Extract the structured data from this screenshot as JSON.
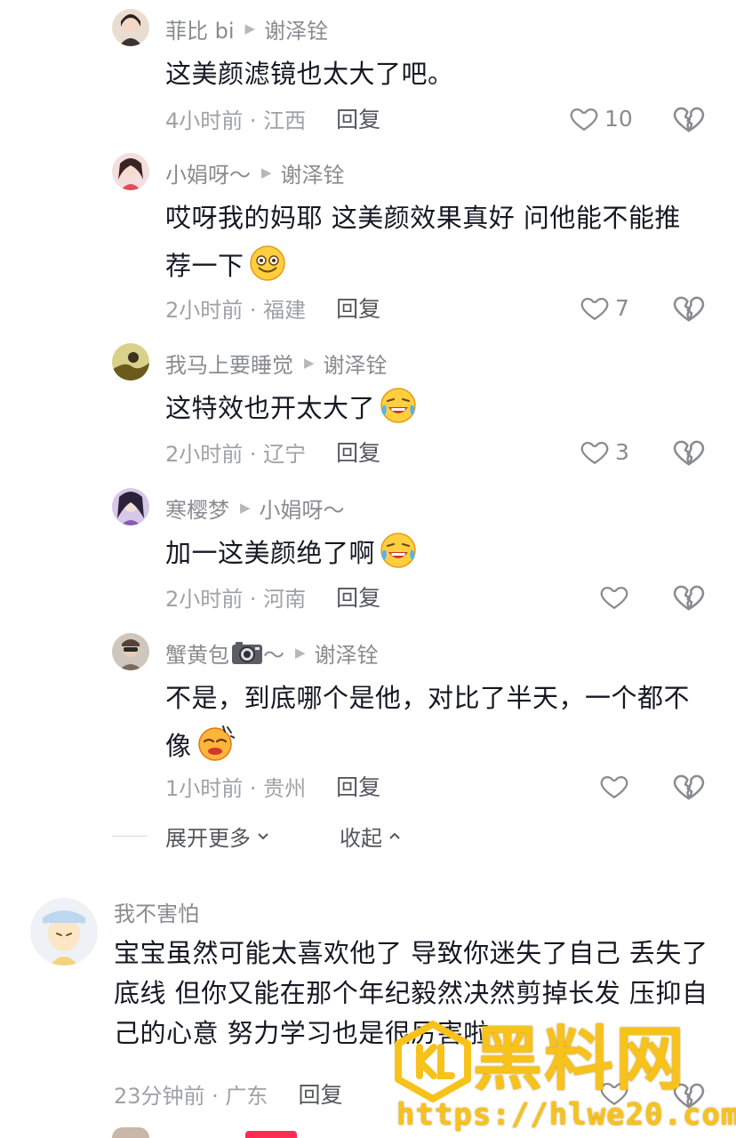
{
  "replies": [
    {
      "user": "菲比 bi",
      "reply_to": "谢泽铨",
      "text": "这美颜滤镜也太大了吧。",
      "emoji": "",
      "time_loc": "4小时前 · 江西",
      "reply_label": "回复",
      "likes": "10"
    },
    {
      "user": "小娟呀～",
      "reply_to": "谢泽铨",
      "text": "哎呀我的妈耶 这美颜效果真好 问他能不能推荐一下",
      "emoji": "smile-emoji",
      "time_loc": "2小时前 · 福建",
      "reply_label": "回复",
      "likes": "7"
    },
    {
      "user": "我马上要睡觉",
      "reply_to": "谢泽铨",
      "text": "这特效也开太大了",
      "emoji": "laugh-cry-emoji",
      "time_loc": "2小时前 · 辽宁",
      "reply_label": "回复",
      "likes": "3"
    },
    {
      "user": "寒樱梦",
      "reply_to": "小娟呀～",
      "text": "加一这美颜绝了啊",
      "emoji": "laugh-cry-emoji",
      "time_loc": "2小时前 · 河南",
      "reply_label": "回复",
      "likes": ""
    },
    {
      "user": "蟹黄包",
      "user_suffix": "～",
      "reply_to": "谢泽铨",
      "text": "不是，到底哪个是他，对比了半天，一个都不像",
      "emoji": "sweat-emoji",
      "time_loc": "1小时前 · 贵州",
      "reply_label": "回复",
      "likes": ""
    }
  ],
  "expand": {
    "more_label": "展开更多",
    "collapse_label": "收起"
  },
  "main_comment": {
    "user": "我不害怕",
    "text": "宝宝虽然可能太喜欢他了 导致你迷失了自己 丢失了底线 但你又能在那个年纪毅然决然剪掉长发 压抑自己的心意 努力学习也是很厉害啦",
    "time_loc": "23分钟前 · 广东",
    "reply_label": "回复"
  },
  "watermark": {
    "text": "黑料网",
    "url": "https://hlwe20.com"
  },
  "colors": {
    "accent": "#fe2c55",
    "watermark": "#f7c21a",
    "secondary_text": "#8a8b91"
  }
}
